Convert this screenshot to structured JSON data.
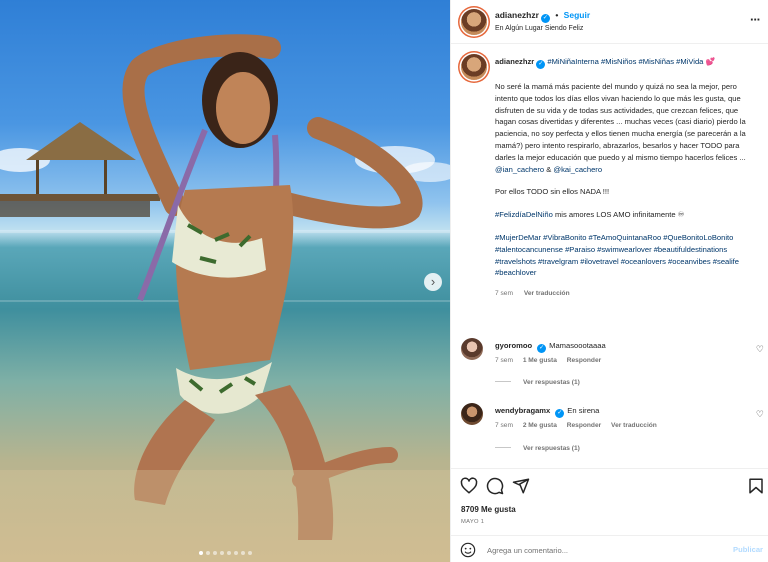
{
  "post": {
    "username": "adianezhzr",
    "follow_label": "Seguir",
    "separator": "•",
    "location": "En Algún Lugar Siendo Feliz",
    "more_label": "···"
  },
  "caption": {
    "username": "adianezhzr",
    "hashtags_top": "#MiNiñaInterna #MisNiños #MisNiñas #MiVida 💕",
    "paragraph1": "No seré la mamá más paciente del mundo y quizá no sea la mejor, pero intento que todos los días ellos vivan haciendo lo que más les gusta, que disfruten de su vida y de todas sus actividades, que crezcan felices, que hagan cosas divertidas y diferentes ... muchas veces (casi diario) pierdo la paciencia, no soy perfecta y ellos tienen mucha energía (se parecerán a la mamá?) pero intento respirarlo, abrazarlos, besarlos y hacer TODO para darles la mejor educación que puedo y al mismo tiempo hacerlos felices ...",
    "mention1": "@ian_cachero",
    "mention_join": " & ",
    "mention2": "@kai_cachero",
    "paragraph2": "Por ellos TODO sin ellos NADA !!!",
    "paragraph3_tag": "#FelizdíaDelNiño",
    "paragraph3_text": " mis amores LOS AMO infinitamente ♾",
    "hashtags_bottom": "#MujerDeMar #VibraBonito #TeAmoQuintanaRoo #QueBonitoLoBonito #talentocancunense #Paraiso #swimwearlover #beautifuldestinations #travelshots #travelgram #ilovetravel #oceanlovers #oceanvibes #sealife #beachlover",
    "time": "7 sem",
    "translation_label": "Ver traducción"
  },
  "comments": [
    {
      "username": "gyoromoo",
      "text": "Mamasoootaaaa",
      "time": "7 sem",
      "likes": "1 Me gusta",
      "reply_label": "Responder",
      "replies_label": "Ver respuestas (1)"
    },
    {
      "username": "wendybragamx",
      "text": "En sirena",
      "time": "7 sem",
      "likes": "2 Me gusta",
      "reply_label": "Responder",
      "translation_label": "Ver traducción",
      "replies_label": "Ver respuestas (1)"
    }
  ],
  "stats": {
    "likes": "8709 Me gusta",
    "date": "MAYO 1"
  },
  "add_comment": {
    "placeholder": "Agrega un comentario...",
    "post_label": "Publicar"
  },
  "carousel": {
    "next_label": "›",
    "slide_count": 8,
    "active_slide": 1
  },
  "colors": {
    "accent": "#0095f6",
    "link": "#00376b",
    "muted": "#737373"
  },
  "icons": [
    "heart-icon",
    "comment-icon",
    "share-icon",
    "save-icon",
    "emoji-icon",
    "verified-icon",
    "more-icon",
    "chevron-right-icon"
  ]
}
